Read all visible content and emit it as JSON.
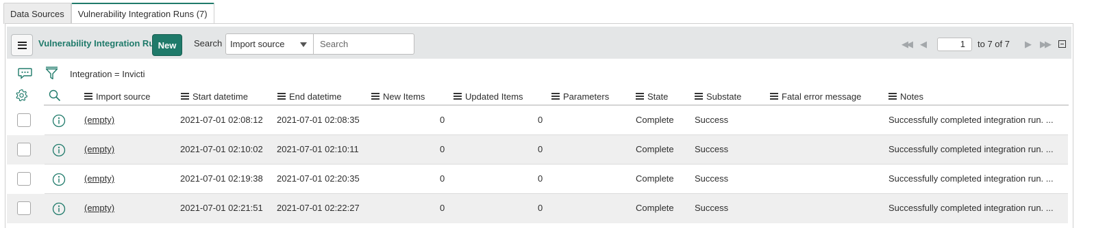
{
  "tabs": [
    {
      "label": "Data Sources"
    },
    {
      "label": "Vulnerability Integration Runs (7)"
    }
  ],
  "toolbar": {
    "title": "Vulnerability Integration Runs",
    "new_label": "New",
    "search_label": "Search",
    "search_field": "Import source",
    "search_placeholder": "Search"
  },
  "pager": {
    "current_page": "1",
    "range_text": "to 7 of 7"
  },
  "filter": {
    "breadcrumb": "Integration = Invicti"
  },
  "columns": [
    "Import source",
    "Start datetime",
    "End datetime",
    "New Items",
    "Updated Items",
    "Parameters",
    "State",
    "Substate",
    "Fatal error message",
    "Notes"
  ],
  "rows": [
    {
      "import_source": "(empty)",
      "start": "2021-07-01 02:08:12",
      "end": "2021-07-01 02:08:35",
      "new_items": "0",
      "updated_items": "0",
      "parameters": "",
      "state": "Complete",
      "substate": "Success",
      "fatal_error": "",
      "notes": "Successfully completed integration run. ..."
    },
    {
      "import_source": "(empty)",
      "start": "2021-07-01 02:10:02",
      "end": "2021-07-01 02:10:11",
      "new_items": "0",
      "updated_items": "0",
      "parameters": "",
      "state": "Complete",
      "substate": "Success",
      "fatal_error": "",
      "notes": "Successfully completed integration run. ..."
    },
    {
      "import_source": "(empty)",
      "start": "2021-07-01 02:19:38",
      "end": "2021-07-01 02:20:35",
      "new_items": "0",
      "updated_items": "0",
      "parameters": "",
      "state": "Complete",
      "substate": "Success",
      "fatal_error": "",
      "notes": "Successfully completed integration run. ..."
    },
    {
      "import_source": "(empty)",
      "start": "2021-07-01 02:21:51",
      "end": "2021-07-01 02:22:27",
      "new_items": "0",
      "updated_items": "0",
      "parameters": "",
      "state": "Complete",
      "substate": "Success",
      "fatal_error": "",
      "notes": "Successfully completed integration run. ..."
    }
  ],
  "colors": {
    "accent": "#1f7a6a",
    "toolbar_bg": "#e4e6e7",
    "alt_row_bg": "#efefef"
  },
  "icons": {
    "menu": "hamburger-icon",
    "chat": "chat-bubble-icon",
    "filter": "funnel-icon",
    "personalize": "gear-icon",
    "column_search": "search-icon",
    "info": "info-icon",
    "pager_first": "double-chevron-left-icon",
    "pager_prev": "chevron-left-icon",
    "pager_next": "chevron-right-icon",
    "pager_last": "double-chevron-right-icon",
    "collapse": "collapse-icon"
  }
}
